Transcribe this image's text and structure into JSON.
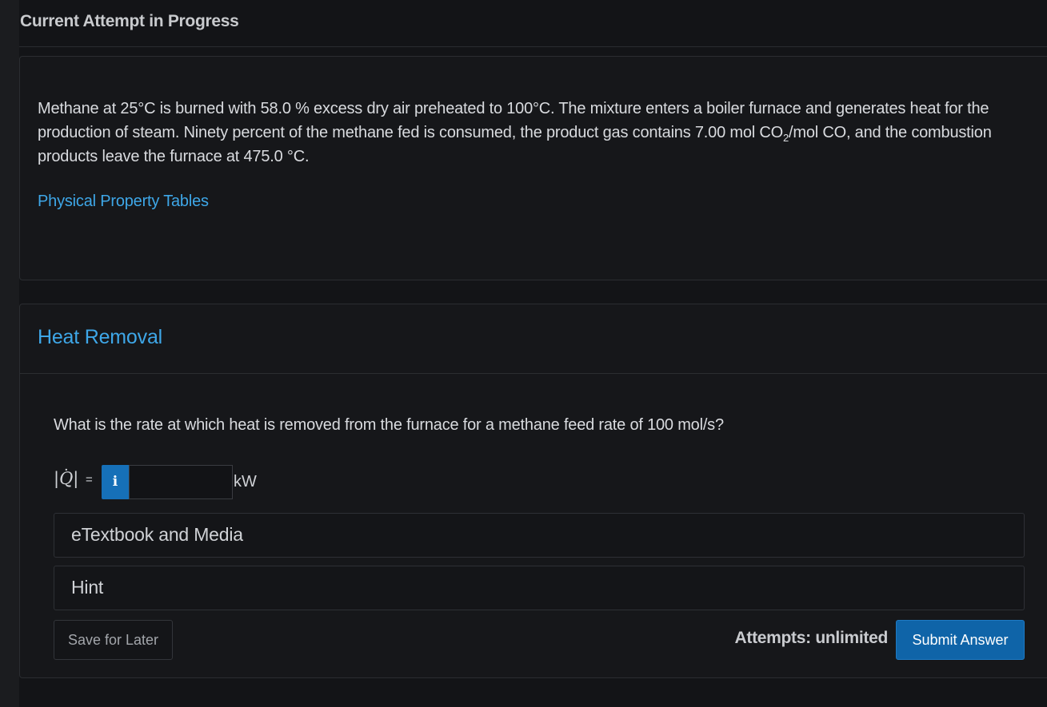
{
  "header": {
    "title": "Current Attempt in Progress"
  },
  "problem": {
    "text_part1": "Methane at 25°C is burned with 58.0 % excess dry air preheated to 100°C. The mixture enters a boiler furnace and generates heat for the production of steam. Ninety percent of the methane fed is consumed, the product gas contains 7.00 mol CO",
    "sub": "2",
    "text_part2": "/mol CO, and the combustion products leave the furnace at 475.0 °C.",
    "link_label": "Physical Property Tables"
  },
  "part": {
    "title": "Heat Removal",
    "question": "What is the rate at which heat is removed from the furnace for a methane feed rate of 100 mol/s?",
    "answer": {
      "bar_left": "|",
      "symbol": "Q",
      "dot": "·",
      "bar_right": "|",
      "equals": "=",
      "info_icon_text": "i",
      "value": "",
      "unit": "kW"
    },
    "accordions": {
      "media": "eTextbook and Media",
      "hint": "Hint"
    },
    "footer": {
      "save_label": "Save for Later",
      "attempts": "Attempts: unlimited",
      "submit_label": "Submit Answer"
    }
  },
  "colors": {
    "accent": "#3ea7e8",
    "button": "#0f64a8",
    "background": "#131417"
  }
}
